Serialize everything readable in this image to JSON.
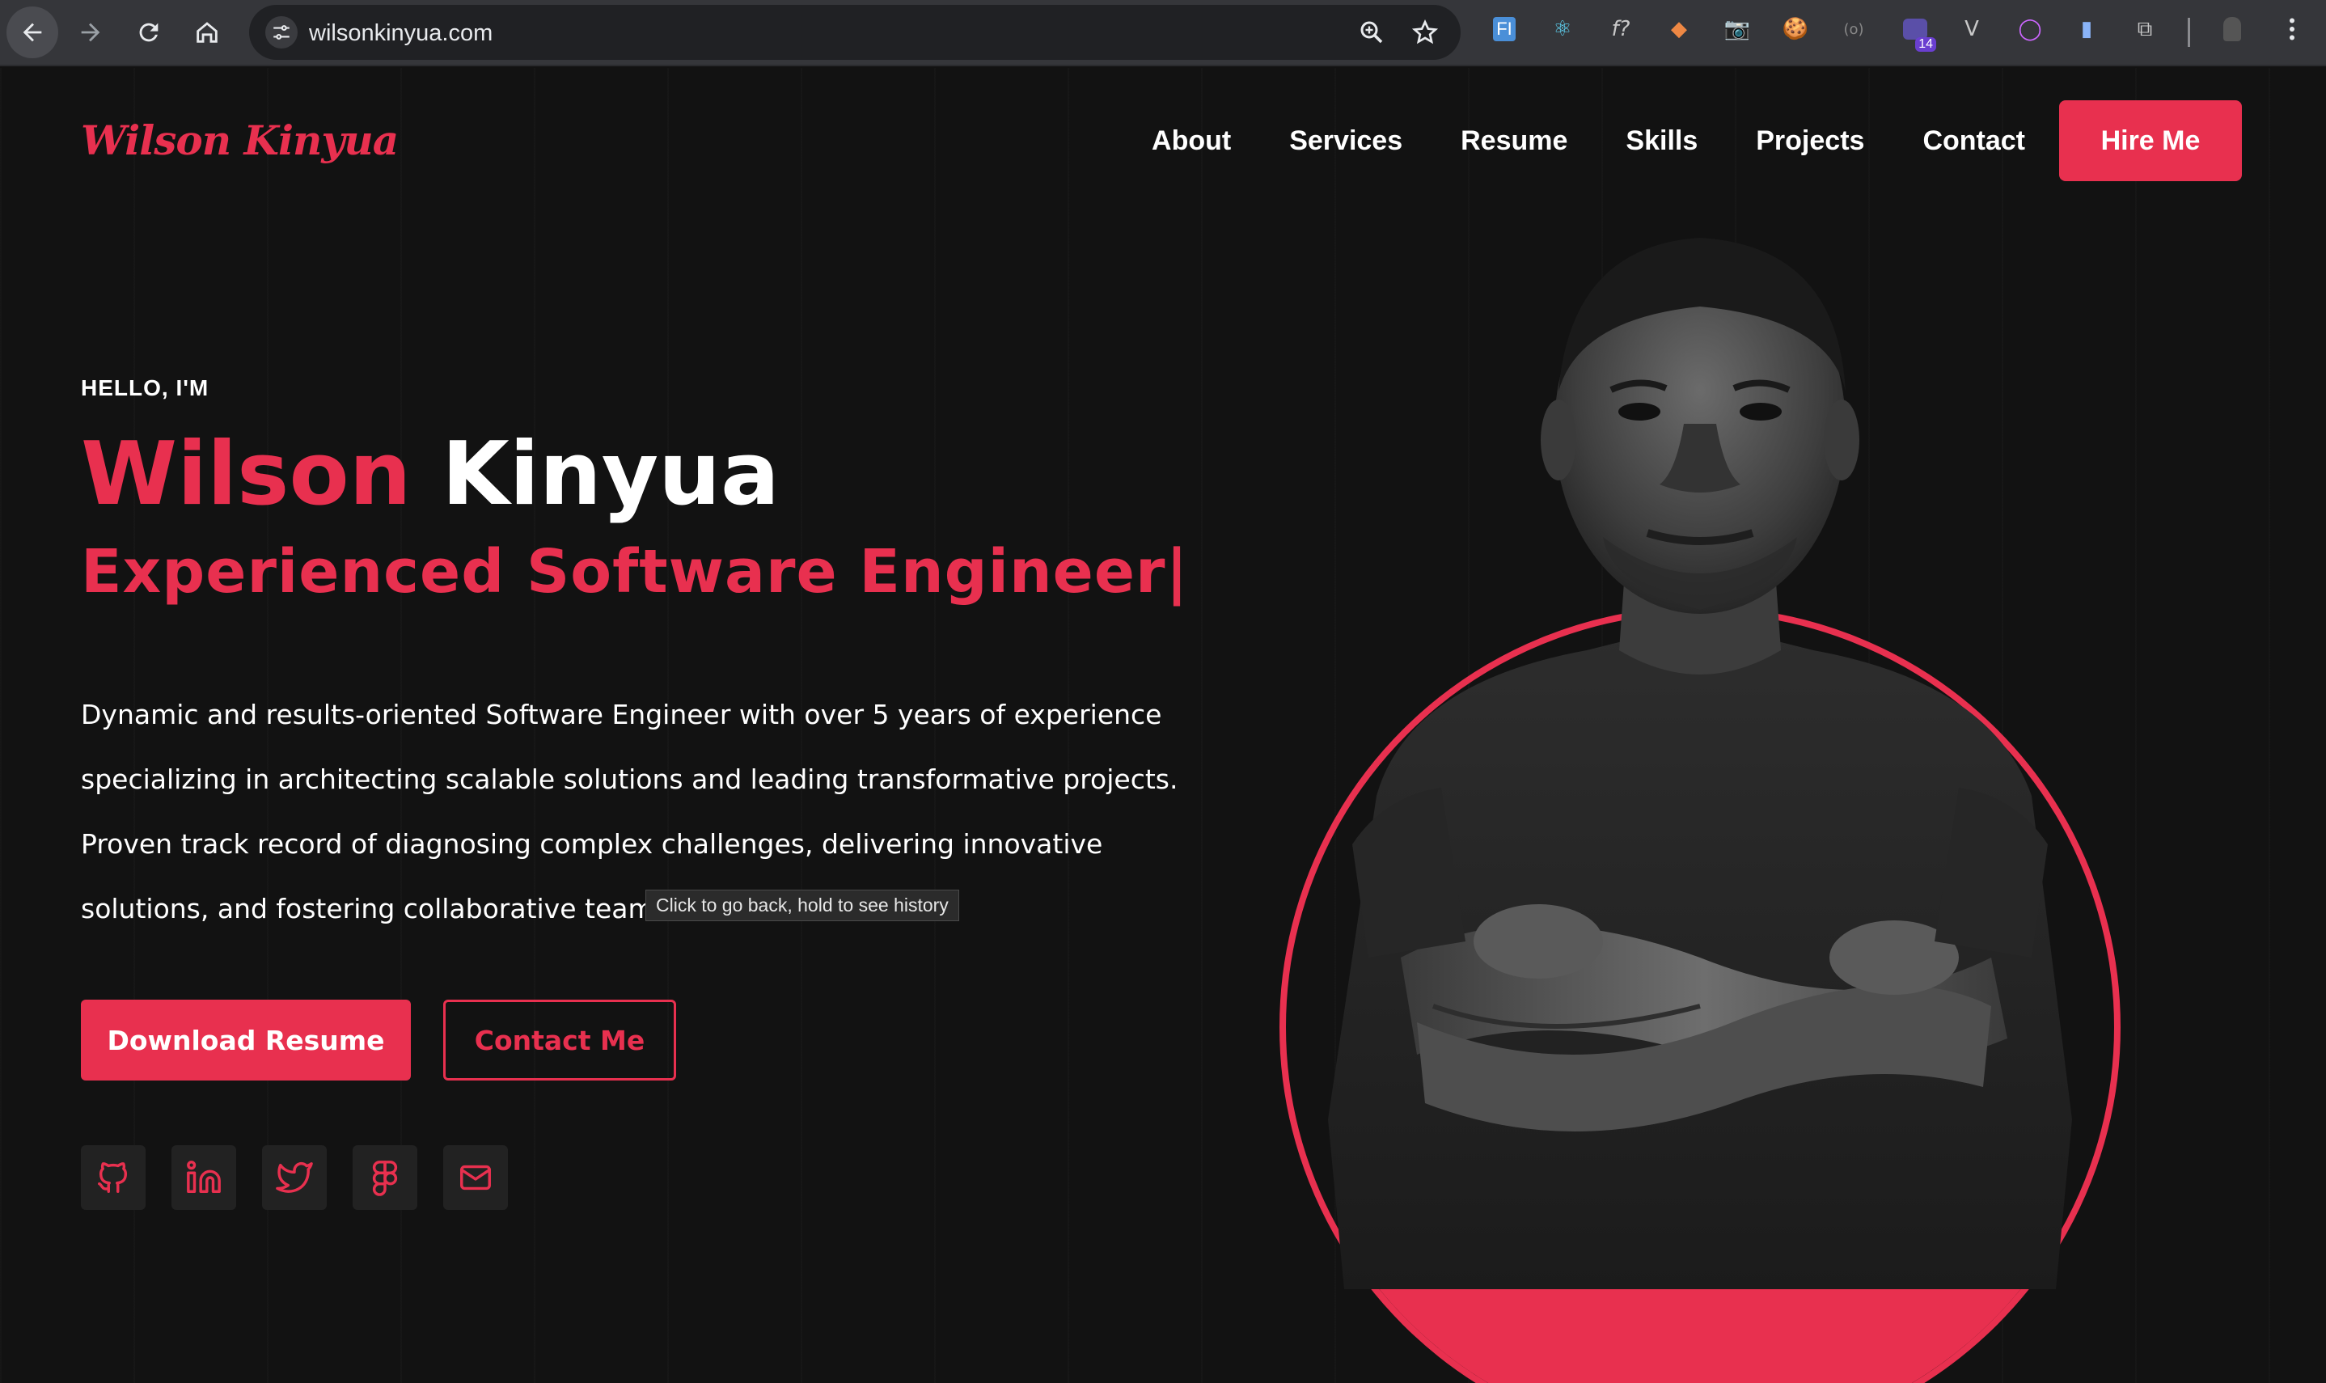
{
  "browser": {
    "url": "wilsonkinyua.com",
    "extensions": [
      "FI",
      "⚛",
      "f?",
      "◆",
      "📷",
      "🍪",
      "(o)",
      "14",
      "V",
      "◯",
      "▮",
      "⧉"
    ],
    "tooltip": "Click to go back, hold to see history"
  },
  "header": {
    "logo_first": "Wilson",
    "logo_last": "Kinyua",
    "nav": [
      "About",
      "Services",
      "Resume",
      "Skills",
      "Projects",
      "Contact"
    ],
    "hire_label": "Hire Me"
  },
  "hero": {
    "greeting": "HELLO, I'M",
    "first_name": "Wilson",
    "last_name": "Kinyua",
    "role": "Experienced Software Engineer|",
    "bio_lines": [
      "Dynamic and results-oriented Software Engineer with over 5 years of experience",
      "specializing in architecting scalable solutions and leading transformative projects.",
      "Proven track record of diagnosing complex challenges, delivering innovative",
      "solutions, and fostering collaborative team e"
    ],
    "download_label": "Download Resume",
    "contact_label": "Contact Me"
  },
  "socials": [
    "github-icon",
    "linkedin-icon",
    "twitter-icon",
    "figma-icon",
    "mail-icon"
  ],
  "colors": {
    "accent": "#e8304f",
    "background": "#121212",
    "chrome": "#35363a"
  }
}
